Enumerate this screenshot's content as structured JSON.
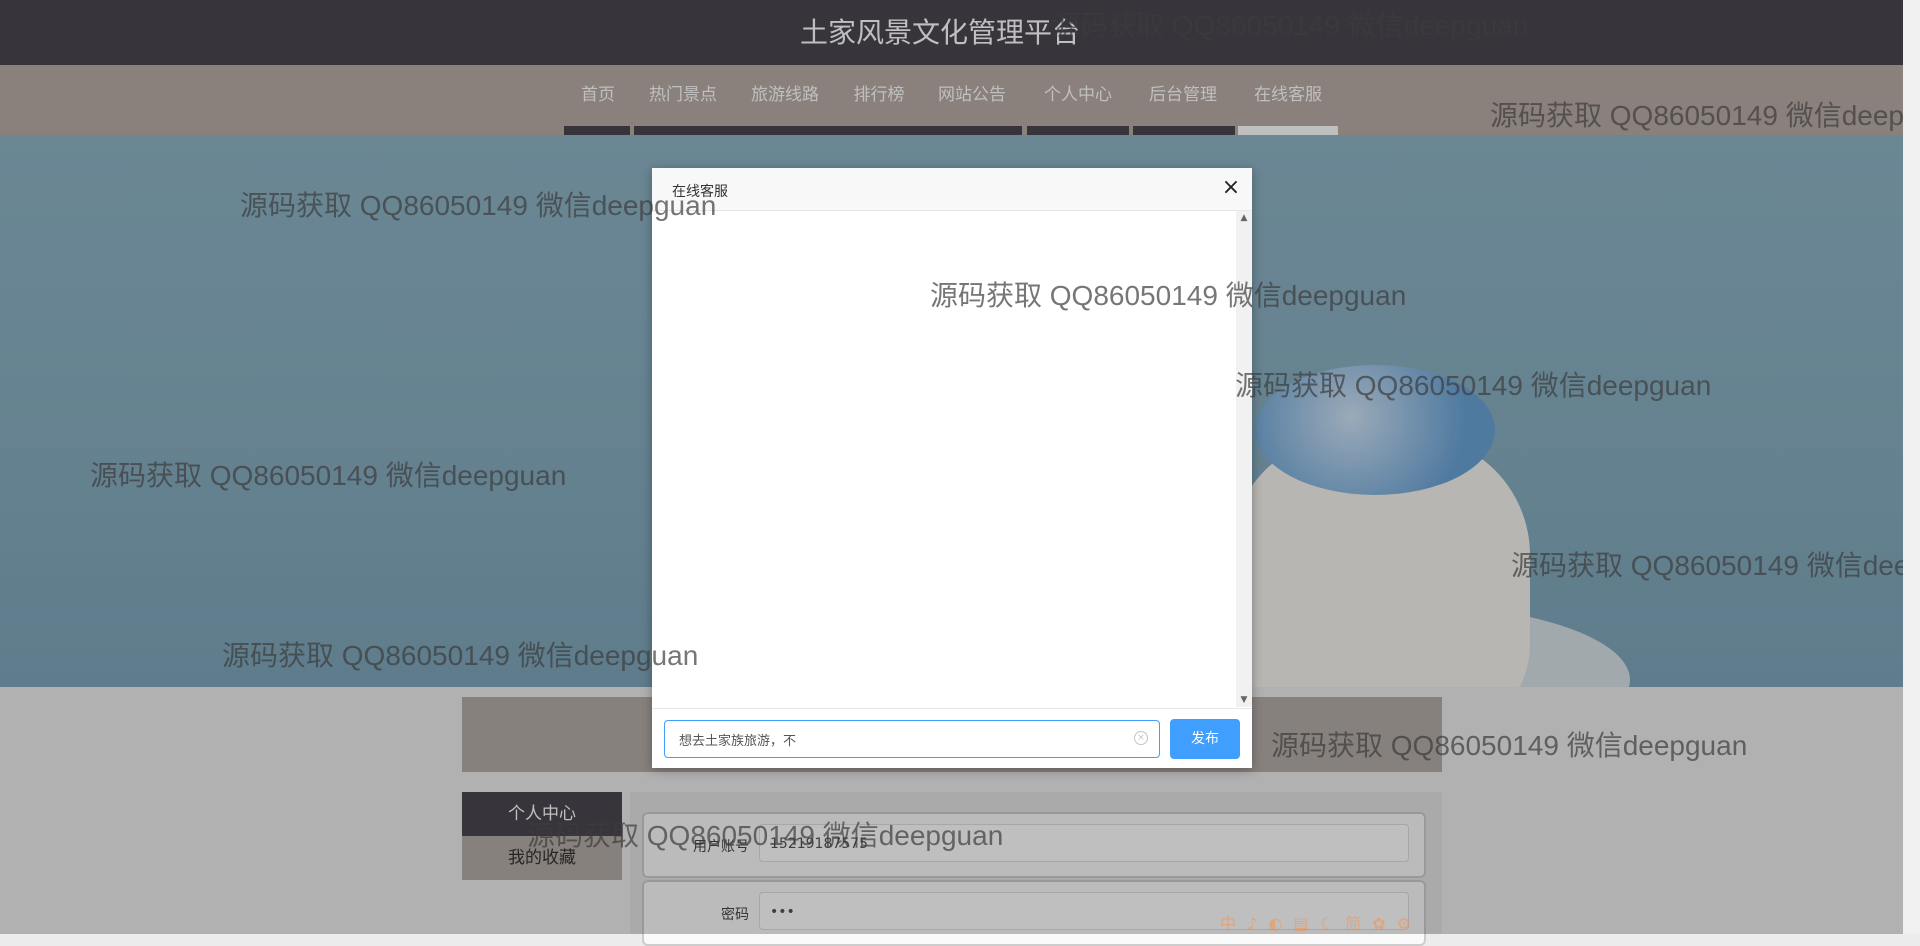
{
  "header": {
    "title": "土家风景文化管理平台"
  },
  "nav": {
    "items": [
      {
        "label": "首页"
      },
      {
        "label": "热门景点"
      },
      {
        "label": "旅游线路"
      },
      {
        "label": "排行榜"
      },
      {
        "label": "网站公告"
      },
      {
        "label": "个人中心"
      },
      {
        "label": "后台管理"
      },
      {
        "label": "在线客服"
      }
    ],
    "active_label": "在线客服"
  },
  "sidebar": {
    "items": [
      {
        "label": "个人中心"
      },
      {
        "label": "我的收藏"
      }
    ]
  },
  "form": {
    "account_label": "用户账号",
    "account_value": "15219187575",
    "password_label": "密码",
    "password_value": "•••"
  },
  "dialog": {
    "title": "在线客服",
    "close_symbol": "×",
    "message_value": "想去土家族旅游，不",
    "send_label": "发布"
  },
  "watermark_text": "源码获取 QQ86050149 微信deepguan",
  "ime_toolbar": "中 ♪ ◐ ▤ ☾ 简 ✿ ⚙"
}
